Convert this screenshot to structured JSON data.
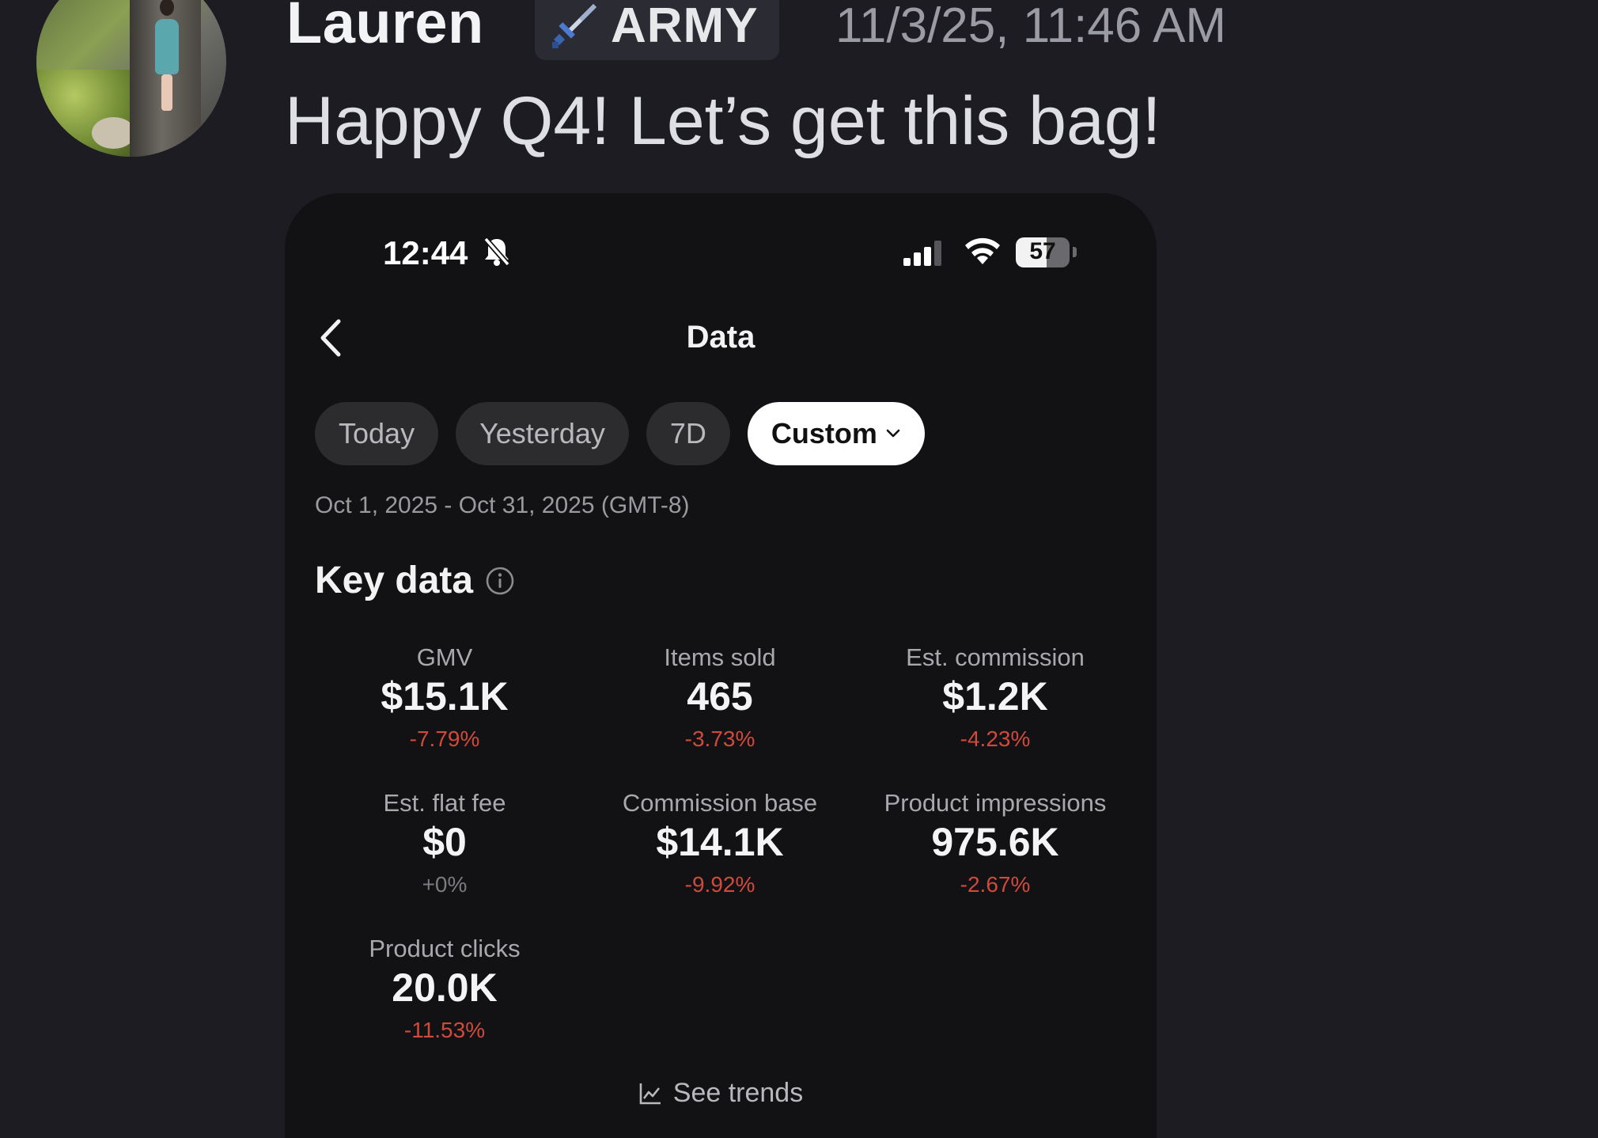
{
  "message": {
    "username": "Lauren",
    "role": {
      "icon": "sword-icon",
      "label": "ARMY"
    },
    "timestamp": "11/3/25, 11:46 AM",
    "text": "Happy Q4! Let’s get this bag!"
  },
  "phone": {
    "status_bar": {
      "time": "12:44",
      "battery_percent": "57",
      "battery_level": 0.57
    },
    "nav": {
      "title": "Data"
    },
    "filters": [
      {
        "label": "Today",
        "selected": false
      },
      {
        "label": "Yesterday",
        "selected": false
      },
      {
        "label": "7D",
        "selected": false
      },
      {
        "label": "Custom",
        "selected": true
      }
    ],
    "date_range": "Oct 1, 2025 - Oct 31, 2025 (GMT-8)",
    "key_data": {
      "title": "Key data",
      "metrics": [
        {
          "label": "GMV",
          "value": "$15.1K",
          "change": "-7.79%"
        },
        {
          "label": "Items sold",
          "value": "465",
          "change": "-3.73%"
        },
        {
          "label": "Est. commission",
          "value": "$1.2K",
          "change": "-4.23%"
        },
        {
          "label": "Est. flat fee",
          "value": "$0",
          "change": "+0%"
        },
        {
          "label": "Commission base",
          "value": "$14.1K",
          "change": "-9.92%"
        },
        {
          "label": "Product impressions",
          "value": "975.6K",
          "change": "-2.67%"
        },
        {
          "label": "Product clicks",
          "value": "20.0K",
          "change": "-11.53%"
        }
      ]
    },
    "see_trends": "See trends"
  },
  "colors": {
    "negative": "#d04a3c",
    "neutral": "#7b7b80",
    "background": "#1c1c22",
    "phone_bg": "#121214"
  }
}
